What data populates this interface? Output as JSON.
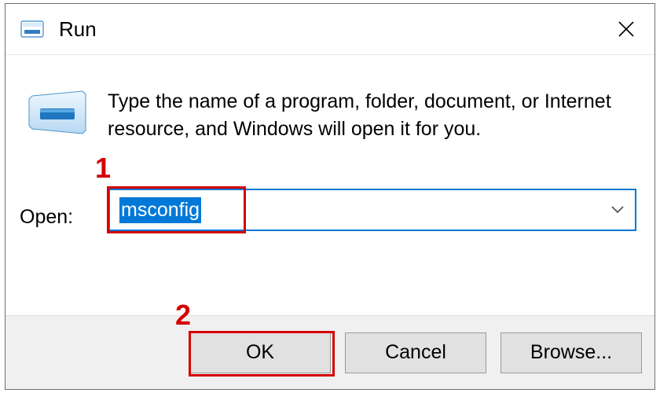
{
  "window": {
    "title": "Run",
    "close_aria": "Close"
  },
  "body": {
    "description": "Type the name of a program, folder, document, or Internet resource, and Windows will open it for you.",
    "open_label": "Open:",
    "input_value": "msconfig"
  },
  "buttons": {
    "ok": "OK",
    "cancel": "Cancel",
    "browse": "Browse..."
  },
  "annotations": {
    "one": "1",
    "two": "2",
    "color": "#d40000"
  },
  "icon": {
    "name": "run-dialog-icon"
  }
}
